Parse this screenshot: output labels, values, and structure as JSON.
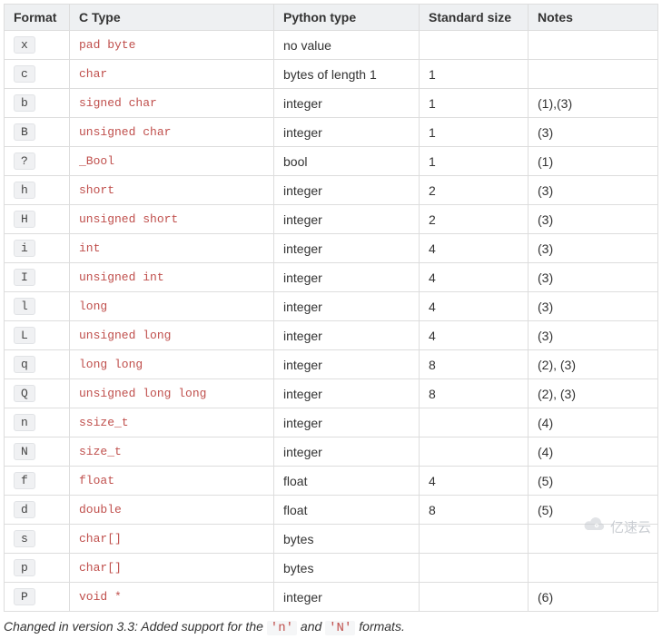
{
  "headers": {
    "format": "Format",
    "ctype": "C Type",
    "pytype": "Python type",
    "size": "Standard size",
    "notes": "Notes"
  },
  "rows": [
    {
      "format": "x",
      "ctype": "pad byte",
      "pytype": "no value",
      "size": "",
      "notes": ""
    },
    {
      "format": "c",
      "ctype": "char",
      "pytype": "bytes of length 1",
      "size": "1",
      "notes": ""
    },
    {
      "format": "b",
      "ctype": "signed char",
      "pytype": "integer",
      "size": "1",
      "notes": "(1),(3)"
    },
    {
      "format": "B",
      "ctype": "unsigned char",
      "pytype": "integer",
      "size": "1",
      "notes": "(3)"
    },
    {
      "format": "?",
      "ctype": "_Bool",
      "pytype": "bool",
      "size": "1",
      "notes": "(1)"
    },
    {
      "format": "h",
      "ctype": "short",
      "pytype": "integer",
      "size": "2",
      "notes": "(3)"
    },
    {
      "format": "H",
      "ctype": "unsigned short",
      "pytype": "integer",
      "size": "2",
      "notes": "(3)"
    },
    {
      "format": "i",
      "ctype": "int",
      "pytype": "integer",
      "size": "4",
      "notes": "(3)"
    },
    {
      "format": "I",
      "ctype": "unsigned int",
      "pytype": "integer",
      "size": "4",
      "notes": "(3)"
    },
    {
      "format": "l",
      "ctype": "long",
      "pytype": "integer",
      "size": "4",
      "notes": "(3)"
    },
    {
      "format": "L",
      "ctype": "unsigned long",
      "pytype": "integer",
      "size": "4",
      "notes": "(3)"
    },
    {
      "format": "q",
      "ctype": "long long",
      "pytype": "integer",
      "size": "8",
      "notes": "(2), (3)"
    },
    {
      "format": "Q",
      "ctype": "unsigned long long",
      "pytype": "integer",
      "size": "8",
      "notes": "(2), (3)"
    },
    {
      "format": "n",
      "ctype": "ssize_t",
      "pytype": "integer",
      "size": "",
      "notes": "(4)"
    },
    {
      "format": "N",
      "ctype": "size_t",
      "pytype": "integer",
      "size": "",
      "notes": "(4)"
    },
    {
      "format": "f",
      "ctype": "float",
      "pytype": "float",
      "size": "4",
      "notes": "(5)"
    },
    {
      "format": "d",
      "ctype": "double",
      "pytype": "float",
      "size": "8",
      "notes": "(5)"
    },
    {
      "format": "s",
      "ctype": "char[]",
      "pytype": "bytes",
      "size": "",
      "notes": ""
    },
    {
      "format": "p",
      "ctype": "char[]",
      "pytype": "bytes",
      "size": "",
      "notes": ""
    },
    {
      "format": "P",
      "ctype": "void *",
      "pytype": "integer",
      "size": "",
      "notes": "(6)"
    }
  ],
  "footnote": {
    "prefix": "Changed in version 3.3:",
    "text_a": " Added support for the ",
    "code_a": "'n'",
    "text_b": " and ",
    "code_b": "'N'",
    "text_c": " formats."
  },
  "watermark": "亿速云"
}
